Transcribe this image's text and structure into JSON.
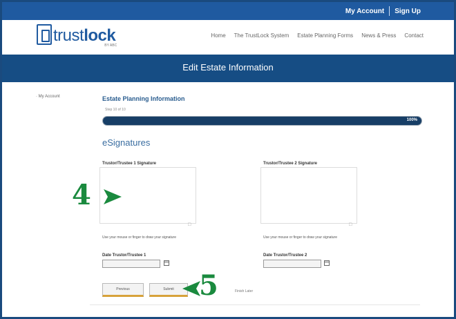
{
  "topbar": {
    "my_account": "My Account",
    "sign_up": "Sign Up"
  },
  "brand": {
    "name_light": "trust",
    "name_bold": "lock",
    "tagline": "BY ABC"
  },
  "nav": [
    "Home",
    "The TrustLock System",
    "Estate Planning Forms",
    "News & Press",
    "Contact"
  ],
  "banner": {
    "title": "Edit Estate Information"
  },
  "sidebar": {
    "link": "· My Account"
  },
  "content": {
    "section_title": "Estate Planning Information",
    "progress_label": "Step 10 of 10",
    "progress_value": 100,
    "progress_text": "100%",
    "subhead": "eSignatures"
  },
  "signatures": [
    {
      "label": "Trustor/Trustee 1 Signature",
      "help": "Use your mouse or finger to draw your signature",
      "date_label": "Date Trustor/Trustee 1",
      "date_value": ""
    },
    {
      "label": "Trustor/Trustee 2 Signature",
      "help": "Use your mouse or finger to draw your signature",
      "date_label": "Date Trustor/Trustee 2",
      "date_value": ""
    }
  ],
  "buttons": {
    "previous": "Previous",
    "submit": "Submit",
    "hint": "Finish Later"
  },
  "callouts": {
    "step4": "4",
    "step5": "5"
  },
  "colors": {
    "brand": "#1f5aa0",
    "banner": "#164d84",
    "callout": "#1a8a3e",
    "button_accent": "#d7a23a"
  }
}
